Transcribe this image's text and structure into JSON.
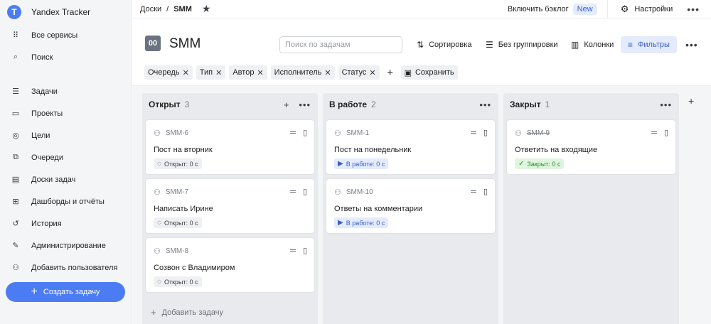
{
  "sidebar": {
    "brand": "Yandex Tracker",
    "brand_logo": "T",
    "items_top": [
      {
        "label": "Все сервисы",
        "icon": "grid-dots-icon",
        "glyph": "⠿"
      },
      {
        "label": "Поиск",
        "icon": "search-icon",
        "glyph": "⌕"
      }
    ],
    "items_main": [
      {
        "label": "Задачи",
        "icon": "tasks-list-icon",
        "glyph": "☰"
      },
      {
        "label": "Проекты",
        "icon": "projects-icon",
        "glyph": "▭"
      },
      {
        "label": "Цели",
        "icon": "target-icon",
        "glyph": "◎"
      },
      {
        "label": "Очереди",
        "icon": "queues-icon",
        "glyph": "⧉"
      },
      {
        "label": "Доски задач",
        "icon": "board-icon",
        "glyph": "▤"
      },
      {
        "label": "Дашборды и отчёты",
        "icon": "dashboard-icon",
        "glyph": "⊞"
      },
      {
        "label": "История",
        "icon": "history-icon",
        "glyph": "↺"
      },
      {
        "label": "Администрирование",
        "icon": "wrench-icon",
        "glyph": "✎"
      },
      {
        "label": "Добавить пользователя",
        "icon": "add-user-icon",
        "glyph": "⚇"
      }
    ],
    "create_button": "Создать задачу"
  },
  "topbar": {
    "crumb_root": "Доски",
    "crumb_sep": "/",
    "crumb_current": "SMM",
    "backlog_label": "Включить бэклог",
    "backlog_badge": "New",
    "settings_label": "Настройки"
  },
  "board": {
    "title": "SMM",
    "icon_glyph": "00",
    "search_placeholder": "Поиск по задачам",
    "sort_label": "Сортировка",
    "group_label": "Без группировки",
    "columns_label": "Колонки",
    "filters_label": "Фильтры"
  },
  "filters": {
    "chips": [
      "Очередь",
      "Тип",
      "Автор",
      "Исполнитель",
      "Статус"
    ],
    "save_label": "Сохранить"
  },
  "columns": [
    {
      "title": "Открыт",
      "count": "3",
      "show_add": true,
      "cards": [
        {
          "key": "SMM-6",
          "summary": "Пост на вторник",
          "status": "Открыт: 0 с",
          "status_type": "open"
        },
        {
          "key": "SMM-7",
          "summary": "Написать Ирине",
          "status": "Открыт: 0 с",
          "status_type": "open"
        },
        {
          "key": "SMM-8",
          "summary": "Созвон с Владимиром",
          "status": "Открыт: 0 с",
          "status_type": "open"
        }
      ],
      "add_task_label": "Добавить задачу"
    },
    {
      "title": "В работе",
      "count": "2",
      "show_add": false,
      "cards": [
        {
          "key": "SMM-1",
          "summary": "Пост на понедельник",
          "status": "В работе: 0 с",
          "status_type": "progress"
        },
        {
          "key": "SMM-10",
          "summary": "Ответы на комментарии",
          "status": "В работе: 0 с",
          "status_type": "progress"
        }
      ]
    },
    {
      "title": "Закрыт",
      "count": "1",
      "show_add": false,
      "cards": [
        {
          "key": "SMM-9",
          "summary": "Ответить на входящие",
          "status": "Закрыт: 0 с",
          "status_type": "closed",
          "done": true
        }
      ]
    }
  ],
  "colors": {
    "accent": "#4c7cf3",
    "sidebar_bg": "#f4f5f7",
    "column_bg": "#e9eaed",
    "progress_text": "#3a5cc9",
    "closed_text": "#2e8a2e"
  }
}
